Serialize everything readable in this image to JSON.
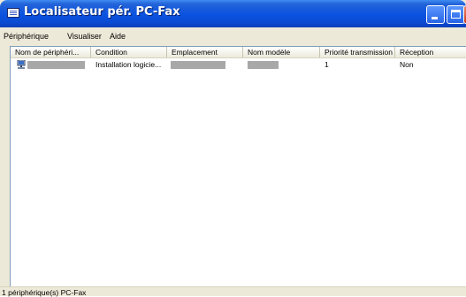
{
  "window": {
    "title": "Localisateur pér. PC-Fax",
    "title_icon": "fax-list-icon",
    "controls": [
      "minimize",
      "maximize",
      "close"
    ]
  },
  "menu": {
    "items": [
      {
        "label": "Périphérique"
      },
      {
        "label": "Visualiser"
      },
      {
        "label": "Aide"
      }
    ]
  },
  "list": {
    "columns": [
      {
        "label": "Nom de périphéri..."
      },
      {
        "label": "Condition"
      },
      {
        "label": "Emplacement"
      },
      {
        "label": "Nom modèle"
      },
      {
        "label": "Priorité transmission"
      },
      {
        "label": "Réception"
      }
    ],
    "rows": [
      {
        "icon": "pc-device-icon",
        "name": "",
        "condition": "Installation logicie...",
        "location": "",
        "model": "",
        "priority": "1",
        "reception": "Non"
      }
    ]
  },
  "status": {
    "text": "1 périphérique(s) PC-Fax"
  },
  "colors": {
    "titlebar": "#0a52e0",
    "window_bg": "#ece9d8",
    "list_bg": "#ffffff",
    "redaction": "#a8a8a8"
  }
}
